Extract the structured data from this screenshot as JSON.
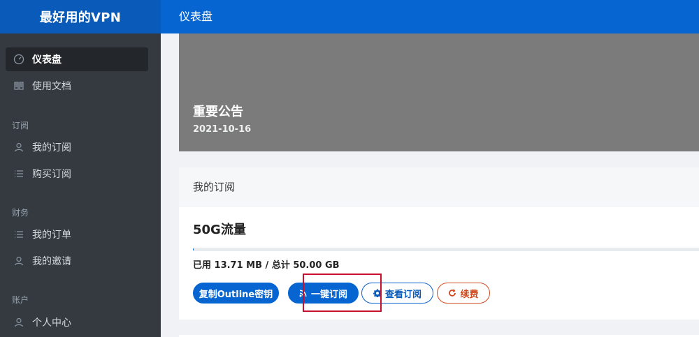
{
  "header": {
    "brand": "最好用的VPN",
    "page_title": "仪表盘"
  },
  "sidebar": {
    "items": [
      {
        "label": "仪表盘",
        "icon": "dashboard-icon",
        "active": true
      },
      {
        "label": "使用文档",
        "icon": "book-icon"
      }
    ],
    "sections": [
      {
        "title": "订阅",
        "items": [
          {
            "label": "我的订阅",
            "icon": "user-icon"
          },
          {
            "label": "购买订阅",
            "icon": "list-icon"
          }
        ]
      },
      {
        "title": "财务",
        "items": [
          {
            "label": "我的订单",
            "icon": "list-icon"
          },
          {
            "label": "我的邀请",
            "icon": "user-icon"
          }
        ]
      },
      {
        "title": "账户",
        "items": [
          {
            "label": "个人中心",
            "icon": "user-icon"
          }
        ]
      }
    ]
  },
  "notice": {
    "title": "重要公告",
    "date": "2021-10-16"
  },
  "subscription": {
    "header": "我的订阅",
    "plan_name": "50G流量",
    "usage_text": "已用 13.71 MB / 总计 50.00 GB",
    "usage_fraction": 0.0003,
    "buttons": {
      "copy_outline": "复制Outline密钥",
      "one_click": "一键订阅",
      "view": "查看订阅",
      "renew": "续费"
    }
  },
  "colors": {
    "primary": "#0665d0",
    "danger": "#d24a1f",
    "sidebar_bg": "#343a40",
    "highlight": "#c8102e"
  }
}
